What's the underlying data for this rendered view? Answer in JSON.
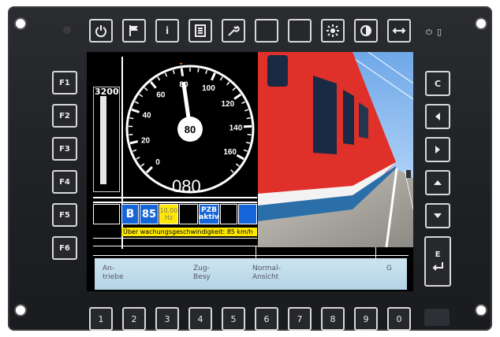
{
  "top_keys": [
    {
      "icon": "power-icon"
    },
    {
      "icon": "flag-icon"
    },
    {
      "icon": "info-icon",
      "label": "i"
    },
    {
      "icon": "document-icon"
    },
    {
      "icon": "wrench-icon"
    },
    {
      "icon": "blank"
    },
    {
      "icon": "blank"
    },
    {
      "icon": "brightness-icon"
    },
    {
      "icon": "contrast-icon"
    },
    {
      "icon": "swap-horizontal-icon"
    }
  ],
  "left_keys": [
    "F1",
    "F2",
    "F3",
    "F4",
    "F5",
    "F6"
  ],
  "right_keys": [
    {
      "label": "C",
      "icon": "clear"
    },
    {
      "icon": "arrow-left-icon"
    },
    {
      "icon": "arrow-right-icon"
    },
    {
      "icon": "arrow-up-icon"
    },
    {
      "icon": "arrow-down-icon"
    },
    {
      "label": "E",
      "icon": "enter-icon"
    }
  ],
  "bottom_keys": [
    "1",
    "2",
    "3",
    "4",
    "5",
    "6",
    "7",
    "8",
    "9",
    "0"
  ],
  "status_symbols": {
    "power": "⏻",
    "battery": "▯"
  },
  "speedo": {
    "tape_label": "3200",
    "needle_value": "80",
    "digital_speed": "080",
    "dial_max": 170,
    "current": 80,
    "ticks": [
      "0",
      "20",
      "40",
      "60",
      "80",
      "100",
      "120",
      "140",
      "160"
    ],
    "target_marker": 80
  },
  "cells": {
    "mode": "B",
    "speed_limit": "85",
    "freq_top": "10.00",
    "freq_unit": "Hz",
    "pzb_line1": "PZB",
    "pzb_line2": "aktiv"
  },
  "warning": "Über wachungsgeschwindigkeit: 85 km/h",
  "softkeys": [
    {
      "label": "An-\ntriebe"
    },
    {
      "label": ""
    },
    {
      "label": "Zug-\nBesy"
    },
    {
      "label": "Normal-\nAnsicht"
    },
    {
      "label": ""
    },
    {
      "label": "G"
    }
  ],
  "colors": {
    "accent_blue": "#1565d8",
    "warn_yellow": "#ffe800",
    "train_red": "#e0302a"
  }
}
